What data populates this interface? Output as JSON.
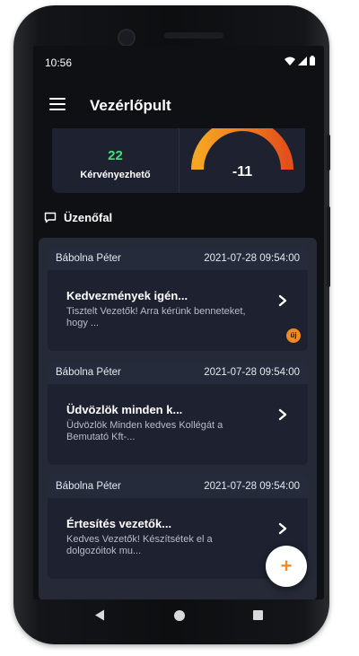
{
  "status_bar": {
    "time": "10:56"
  },
  "app_bar": {
    "title": "Vezérlőpult"
  },
  "stats": {
    "eligible": {
      "value": "22",
      "label": "Kérvényezhető"
    },
    "balance": {
      "value": "-11"
    }
  },
  "message_wall": {
    "title": "Üzenőfal",
    "messages": [
      {
        "author": "Bábolna Péter",
        "date": "2021-07-28 09:54:00",
        "title": "Kedvezmények igén...",
        "body": "Tisztelt Vezetők! Arra kérünk benneteket, hogy ...",
        "badge": "új"
      },
      {
        "author": "Bábolna Péter",
        "date": "2021-07-28 09:54:00",
        "title": "Üdvözlök minden k...",
        "body": "Üdvözlök Minden kedves Kollégát a Bemutató Kft-..."
      },
      {
        "author": "Bábolna Péter",
        "date": "2021-07-28 09:54:00",
        "title": "Értesítés vezetők...",
        "body": "Kedves Vezetők! Készítsétek el a dolgozóitok mu..."
      }
    ]
  },
  "fab": {
    "label": "+"
  },
  "colors": {
    "accent": "#f08a24",
    "positive": "#3fe07a",
    "card": "#1d2130"
  }
}
